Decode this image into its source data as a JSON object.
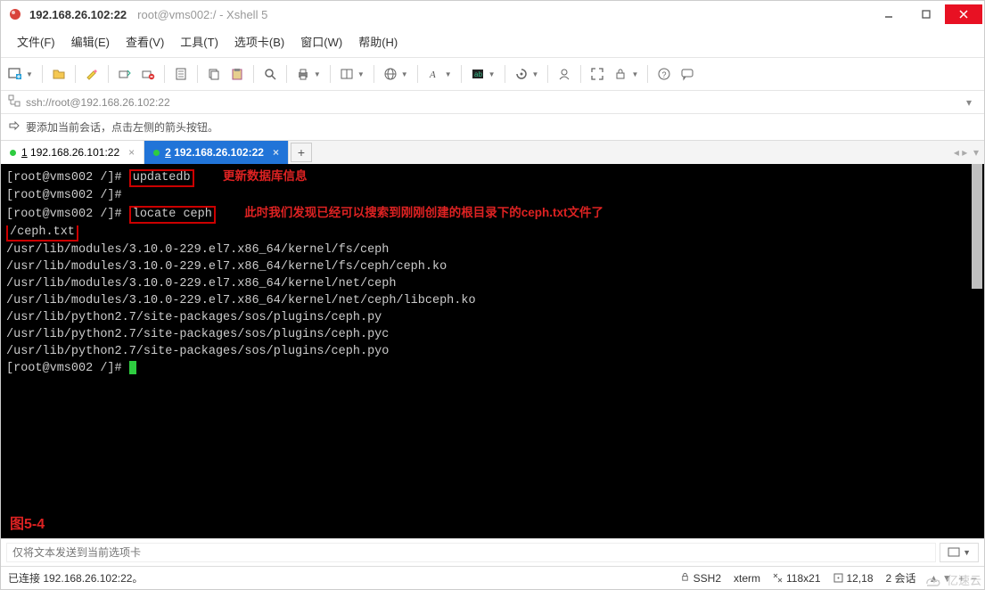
{
  "titlebar": {
    "main": "192.168.26.102:22",
    "sub": "root@vms002:/ - Xshell 5"
  },
  "menu": {
    "file": "文件(F)",
    "edit": "编辑(E)",
    "view": "查看(V)",
    "tools": "工具(T)",
    "tabs": "选项卡(B)",
    "window": "窗口(W)",
    "help": "帮助(H)"
  },
  "addressbar": {
    "url": "ssh://root@192.168.26.102:22"
  },
  "hint": "要添加当前会话，点击左侧的箭头按钮。",
  "tabs": [
    {
      "num": "1",
      "label": "192.168.26.101:22",
      "active": false
    },
    {
      "num": "2",
      "label": "192.168.26.102:22",
      "active": true
    }
  ],
  "terminal": {
    "lines": {
      "l1_prompt": "[root@vms002 /]# ",
      "l1_cmd": "updatedb",
      "l1_annot": "更新数据库信息",
      "l2": "[root@vms002 /]#",
      "l3_prompt": "[root@vms002 /]# ",
      "l3_cmd": "locate ceph",
      "l3_annot": "此时我们发现已经可以搜索到刚刚创建的根目录下的ceph.txt文件了",
      "l4": "/ceph.txt",
      "l5": "/usr/lib/modules/3.10.0-229.el7.x86_64/kernel/fs/ceph",
      "l6": "/usr/lib/modules/3.10.0-229.el7.x86_64/kernel/fs/ceph/ceph.ko",
      "l7": "/usr/lib/modules/3.10.0-229.el7.x86_64/kernel/net/ceph",
      "l8": "/usr/lib/modules/3.10.0-229.el7.x86_64/kernel/net/ceph/libceph.ko",
      "l9": "/usr/lib/python2.7/site-packages/sos/plugins/ceph.py",
      "l10": "/usr/lib/python2.7/site-packages/sos/plugins/ceph.pyc",
      "l11": "/usr/lib/python2.7/site-packages/sos/plugins/ceph.pyo",
      "l12_prompt": "[root@vms002 /]# "
    },
    "figure_label": "图5-4"
  },
  "sendbar": {
    "placeholder": "仅将文本发送到当前选项卡"
  },
  "statusbar": {
    "conn": "已连接 192.168.26.102:22。",
    "proto": "SSH2",
    "term": "xterm",
    "size": "118x21",
    "cursor": "12,18",
    "sessions": "2 会话"
  },
  "watermark": "亿速云"
}
